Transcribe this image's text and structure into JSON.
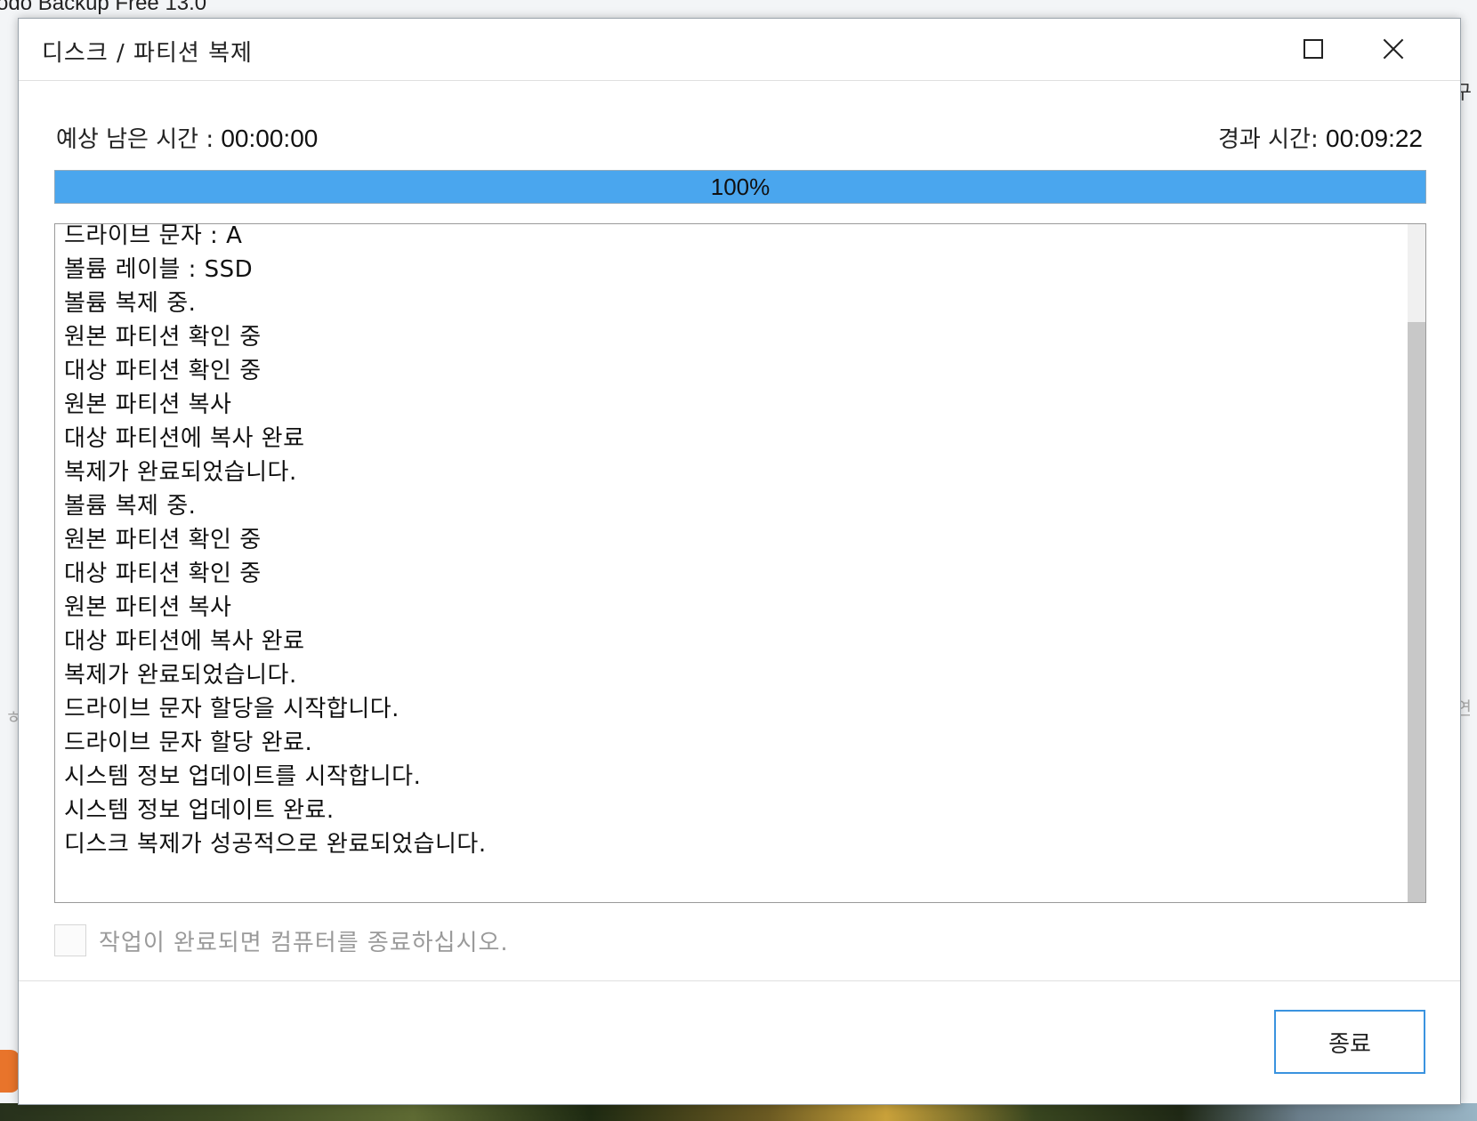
{
  "background": {
    "app_title": "odo Backup Free 13.0",
    "right_glyph_top": "구",
    "right_glyph_mid": "연",
    "left_glyph_mid": "ㅎ"
  },
  "dialog": {
    "title": "디스크 / 파티션 복제",
    "remaining_label": "예상 남은 시간 : ",
    "remaining_value": "00:00:00",
    "elapsed_label": "경과 시간: ",
    "elapsed_value": "00:09:22",
    "progress_text": "100%",
    "progress_percent": 100,
    "log": [
      "드라이브 문자 : A",
      "볼륨 레이블 : SSD",
      "볼륨 복제 중.",
      "원본 파티션 확인 중",
      "대상 파티션 확인 중",
      "원본 파티션 복사",
      "대상 파티션에 복사 완료",
      "복제가 완료되었습니다.",
      "볼륨 복제 중.",
      "원본 파티션 확인 중",
      "대상 파티션 확인 중",
      "원본 파티션 복사",
      "대상 파티션에 복사 완료",
      "복제가 완료되었습니다.",
      "드라이브 문자 할당을 시작합니다.",
      "드라이브 문자 할당 완료.",
      "시스템 정보 업데이트를 시작합니다.",
      "시스템 정보 업데이트 완료.",
      "디스크 복제가 성공적으로 완료되었습니다."
    ],
    "shutdown_checkbox_label": "작업이 완료되면 컴퓨터를 종료하십시오.",
    "shutdown_checked": false,
    "close_button_label": "종료"
  },
  "colors": {
    "progress_fill": "#4aa6ee",
    "button_border": "#3a93df"
  }
}
